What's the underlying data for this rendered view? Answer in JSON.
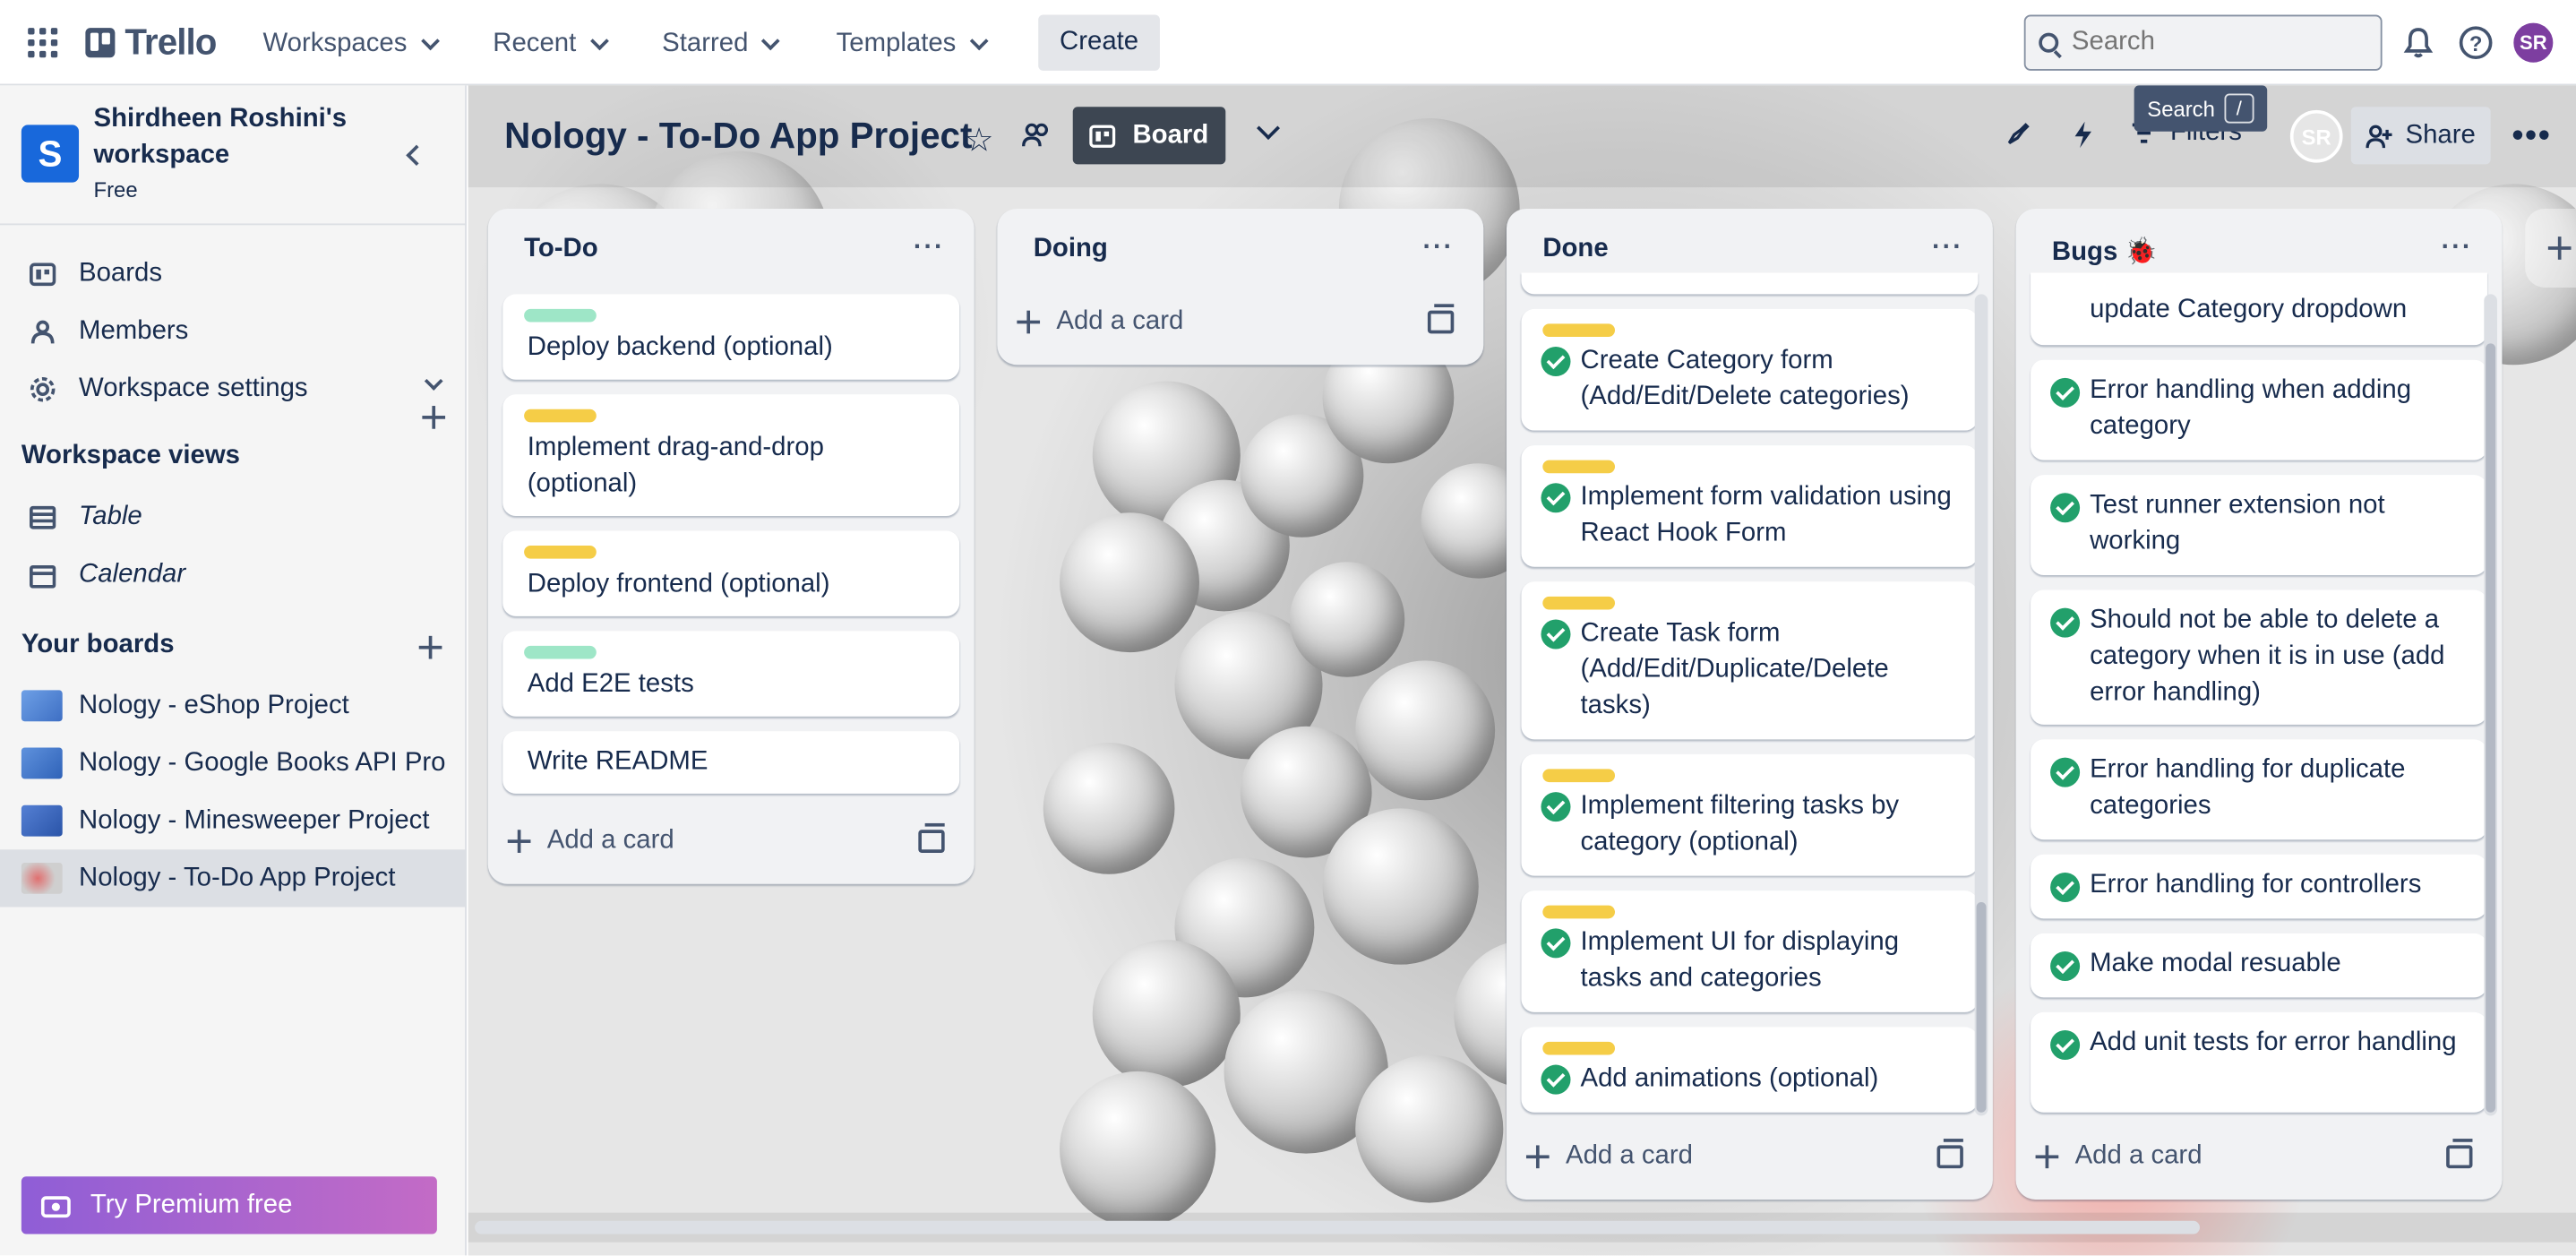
{
  "topbar": {
    "logo": "Trello",
    "nav": [
      "Workspaces",
      "Recent",
      "Starred",
      "Templates"
    ],
    "create_label": "Create",
    "search_placeholder": "Search",
    "avatar_initials": "SR"
  },
  "tooltip": {
    "label": "Search",
    "shortcut": "/"
  },
  "sidebar": {
    "workspace_initial": "S",
    "workspace_name": "Shirdheen Roshini's workspace",
    "workspace_plan": "Free",
    "items": [
      {
        "label": "Boards"
      },
      {
        "label": "Members"
      },
      {
        "label": "Workspace settings"
      }
    ],
    "views_title": "Workspace views",
    "views": [
      {
        "label": "Table"
      },
      {
        "label": "Calendar"
      }
    ],
    "boards_title": "Your boards",
    "boards": [
      {
        "label": "Nology - eShop Project",
        "color": "#5a8fd8"
      },
      {
        "label": "Nology - Google Books API Pro",
        "color": "#4f7fd0"
      },
      {
        "label": "Nology - Minesweeper Project",
        "color": "#3f6fc9"
      },
      {
        "label": "Nology - To-Do App Project",
        "color": "#d9a6a6"
      }
    ],
    "premium_label": "Try Premium free"
  },
  "board": {
    "title": "Nology - To-Do App Project",
    "view_label": "Board",
    "filters_label": "Filters",
    "avatar_initials": "SR",
    "share_label": "Share"
  },
  "lists": [
    {
      "title": "To-Do",
      "cards": [
        {
          "label": "green",
          "text": "Deploy backend (optional)"
        },
        {
          "label": "yellow",
          "text": "Implement drag-and-drop (optional)"
        },
        {
          "label": "yellow",
          "text": "Deploy frontend (optional)"
        },
        {
          "label": "green",
          "text": "Add E2E tests"
        },
        {
          "label": "",
          "text": "Write README"
        }
      ],
      "add_label": "Add a card"
    },
    {
      "title": "Doing",
      "cards": [],
      "add_label": "Add a card"
    },
    {
      "title": "Done",
      "cards": [
        {
          "label": "yellow",
          "text": "Create Category form (Add/Edit/Delete categories)"
        },
        {
          "label": "yellow",
          "text": "Implement form validation using React Hook Form"
        },
        {
          "label": "yellow",
          "text": "Create Task form (Add/Edit/Duplicate/Delete tasks)"
        },
        {
          "label": "yellow",
          "text": "Implement filtering tasks by category (optional)"
        },
        {
          "label": "yellow",
          "text": "Implement UI for displaying tasks and categories"
        },
        {
          "label": "yellow",
          "text": "Add animations (optional)"
        }
      ],
      "add_label": "Add a card"
    },
    {
      "title": "Bugs 🐞",
      "cards": [
        {
          "text": "update Category dropdown"
        },
        {
          "text": "Error handling when adding category"
        },
        {
          "text": "Test runner extension not working"
        },
        {
          "text": "Should not be able to delete a category when it is in use (add error handling)"
        },
        {
          "text": "Error handling for duplicate categories"
        },
        {
          "text": "Error handling for controllers"
        },
        {
          "text": "Make modal resuable"
        },
        {
          "text": "Add unit tests for error handling"
        }
      ],
      "add_label": "Add a card"
    }
  ]
}
